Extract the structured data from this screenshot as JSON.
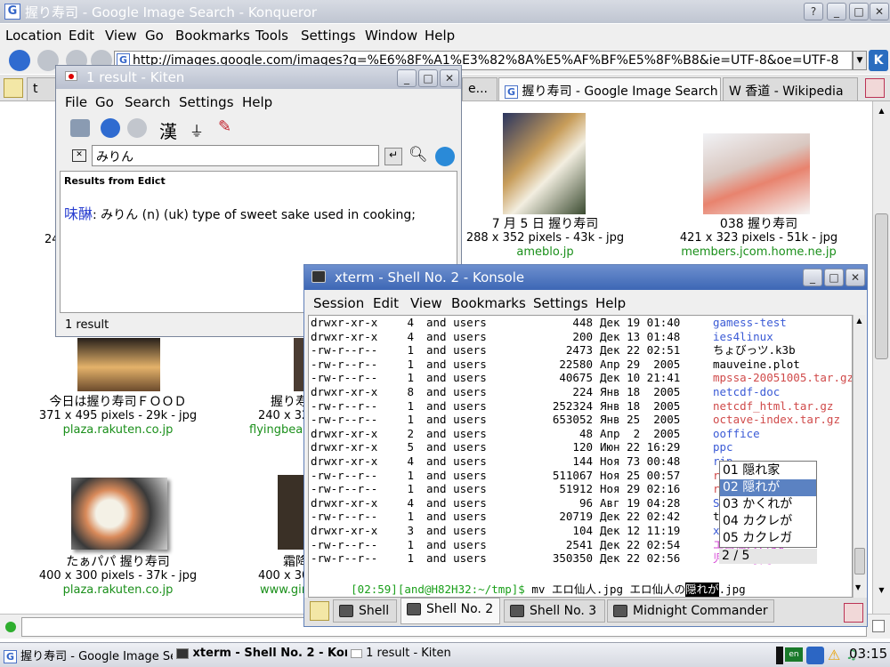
{
  "konqueror": {
    "title": "握り寿司 - Google Image Search - Konqueror",
    "menu": [
      "Location",
      "Edit",
      "View",
      "Go",
      "Bookmarks",
      "Tools",
      "Settings",
      "Window",
      "Help"
    ],
    "url": "http://images.google.com/images?q=%E6%8F%A1%E3%82%8A%E5%AF%BF%E5%8F%B8&ie=UTF-8&oe=UTF-8",
    "tabs": [
      {
        "label": "t"
      },
      {
        "label": "e..."
      },
      {
        "label": "握り寿司 - Google Image Search"
      },
      {
        "label": "W 香道 - Wikipedia"
      }
    ],
    "results": [
      {
        "title": "7 月 5 日 握り寿司",
        "size": "288 x 352 pixels - 43k - jpg",
        "domain": "ameblo.jp"
      },
      {
        "title": "038 握り寿司",
        "size": "421 x 323 pixels - 51k - jpg",
        "domain": "members.jcom.home.ne.jp"
      },
      {
        "title": "今日は握り寿司ＦＯＯＤ",
        "size": "371 x 495 pixels - 29k - jpg",
        "domain": "plaza.rakuten.co.jp"
      },
      {
        "title": "握り寿",
        "size": "240 x 32",
        "domain": "flyingbear"
      },
      {
        "title": "たぁパパ 握り寿司",
        "size": "400 x 300 pixels - 37k - jpg",
        "domain": "plaza.rakuten.co.jp"
      },
      {
        "title": "霜降",
        "size": "400 x 30",
        "domain": "www.gin"
      }
    ],
    "partial_left": "24"
  },
  "kiten": {
    "title": "1 result - Kiten",
    "menu": [
      "File",
      "Go",
      "Search",
      "Settings",
      "Help"
    ],
    "search_value": "みりん",
    "kanji_button": "漢",
    "results_heading": "Results from Edict",
    "entry_word": "味醂",
    "entry_text": ": みりん (n) (uk) type of sweet sake used in cooking;",
    "status": "1 result"
  },
  "konsole": {
    "title": "xterm - Shell No. 2 - Konsole",
    "menu": [
      "Session",
      "Edit",
      "View",
      "Bookmarks",
      "Settings",
      "Help"
    ],
    "rows": [
      {
        "perm": "drwxr-xr-x",
        "n": "4",
        "owner": "and users",
        "size": "448",
        "date": "Дек 19 01:40",
        "name": "gamess-test",
        "color": "#3b5bd6"
      },
      {
        "perm": "drwxr-xr-x",
        "n": "4",
        "owner": "and users",
        "size": "200",
        "date": "Дек 13 01:48",
        "name": "ies4linux",
        "color": "#3b5bd6"
      },
      {
        "perm": "-rw-r--r--",
        "n": "1",
        "owner": "and users",
        "size": "2473",
        "date": "Дек 22 02:51",
        "name": "ちょびっツ.k3b",
        "color": "#000000"
      },
      {
        "perm": "-rw-r--r--",
        "n": "1",
        "owner": "and users",
        "size": "22580",
        "date": "Апр 29  2005",
        "name": "mauveine.plot",
        "color": "#000000"
      },
      {
        "perm": "-rw-r--r--",
        "n": "1",
        "owner": "and users",
        "size": "40675",
        "date": "Дек 10 21:41",
        "name": "mpssa-20051005.tar.gz",
        "color": "#d04a4a"
      },
      {
        "perm": "drwxr-xr-x",
        "n": "8",
        "owner": "and users",
        "size": "224",
        "date": "Янв 18  2005",
        "name": "netcdf-doc",
        "color": "#3b5bd6"
      },
      {
        "perm": "-rw-r--r--",
        "n": "1",
        "owner": "and users",
        "size": "252324",
        "date": "Янв 18  2005",
        "name": "netcdf_html.tar.gz",
        "color": "#d04a4a"
      },
      {
        "perm": "-rw-r--r--",
        "n": "1",
        "owner": "and users",
        "size": "653052",
        "date": "Янв 25  2005",
        "name": "octave-index.tar.gz",
        "color": "#d04a4a"
      },
      {
        "perm": "drwxr-xr-x",
        "n": "2",
        "owner": "and users",
        "size": "48",
        "date": "Апр  2  2005",
        "name": "ooffice",
        "color": "#3b5bd6"
      },
      {
        "perm": "drwxr-xr-x",
        "n": "5",
        "owner": "and users",
        "size": "120",
        "date": "Июн 22 16:29",
        "name": "ppc",
        "color": "#3b5bd6"
      },
      {
        "perm": "drwxr-xr-x",
        "n": "4",
        "owner": "and users",
        "size": "144",
        "date": "Ноя 73 00:48",
        "name": "rip",
        "color": "#3b5bd6"
      },
      {
        "perm": "-rw-r--r--",
        "n": "1",
        "owner": "and users",
        "size": "511067",
        "date": "Ноя 25 00:57",
        "name": "rus-ispell.t",
        "color": "#d04a4a"
      },
      {
        "perm": "-rw-r--r--",
        "n": "1",
        "owner": "and users",
        "size": "51912",
        "date": "Ноя 29 02:16",
        "name": "rusthesis_Te",
        "color": "#d04a4a"
      },
      {
        "perm": "drwxr-xr-x",
        "n": "4",
        "owner": "and users",
        "size": "96",
        "date": "Авг 19 04:28",
        "name": "SNES",
        "color": "#3b5bd6"
      },
      {
        "perm": "-rw-r--r--",
        "n": "1",
        "owner": "and users",
        "size": "20719",
        "date": "Дек 22 02:42",
        "name": "test5",
        "color": "#000000"
      },
      {
        "perm": "drwxr-xr-x",
        "n": "3",
        "owner": "and users",
        "size": "104",
        "date": "Дек 12 11:19",
        "name": "xpthemes",
        "color": "#3b5bd6"
      },
      {
        "perm": "-rw-r--r--",
        "n": "1",
        "owner": "and users",
        "size": "2541",
        "date": "Дек 22 02:54",
        "name": "エロ仙人.jpg",
        "color": "#d64ad6"
      },
      {
        "perm": "-rw-r--r--",
        "n": "1",
        "owner": "and users",
        "size": "350350",
        "date": "Дек 22 02:56",
        "name": "児雷也.jpg",
        "color": "#d64ad6"
      }
    ],
    "prompt": "[02:59][and@H82H32:~/tmp]$",
    "command_pre": " mv エロ仙人.jpg エロ仙人の",
    "command_sel": "隠れが",
    "command_post": ".jpg",
    "ime_candidates": [
      "01 隠れ家",
      "02 隠れが",
      "03 かくれが",
      "04 カクレが",
      "05 カクレガ"
    ],
    "ime_selected_index": 1,
    "ime_page": "2 / 5",
    "tabs": [
      "Shell",
      "Shell No. 2",
      "Shell No. 3",
      "Midnight Commander"
    ]
  },
  "taskbar": {
    "tasks": [
      "握り寿司 - Google Image Se",
      "xterm - Shell No. 2 - Kon",
      "1 result - Kiten"
    ],
    "clock": "03:15"
  },
  "colors": {
    "link_green": "#1a8f1a",
    "dir_blue": "#3b5bd6",
    "archive_red": "#d04a4a",
    "image_magenta": "#d64ad6"
  }
}
